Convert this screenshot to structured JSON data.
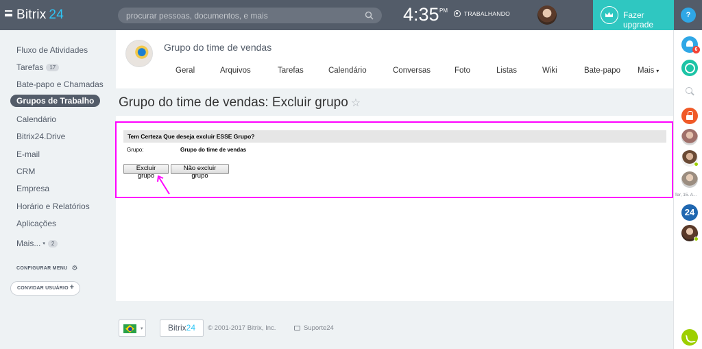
{
  "topbar": {
    "logo_name": "Bitrix",
    "logo_number": "24",
    "search_placeholder": "procurar pessoas, documentos, e mais",
    "time": "4:35",
    "time_period": "PM",
    "work_status": "TRABALHANDO",
    "upgrade_label": "Fazer upgrade",
    "help_label": "?"
  },
  "sidebar": {
    "items": [
      {
        "label": "Fluxo de Atividades"
      },
      {
        "label": "Tarefas",
        "counter": "17"
      },
      {
        "label": "Bate-papo e Chamadas"
      },
      {
        "label": "Grupos de Trabalho",
        "active": true
      },
      {
        "label": "Calendário"
      },
      {
        "label": "Bitrix24.Drive"
      },
      {
        "label": "E-mail"
      },
      {
        "label": "CRM"
      },
      {
        "label": "Empresa"
      },
      {
        "label": "Horário e Relatórios"
      },
      {
        "label": "Aplicações"
      },
      {
        "label": "Mais...",
        "counter": "2"
      }
    ],
    "configure_menu": "CONFIGURAR MENU",
    "invite_user": "CONVIDAR USUÁRIO"
  },
  "group": {
    "name": "Grupo do time de vendas",
    "tabs": [
      "Geral",
      "Arquivos",
      "Tarefas",
      "Calendário",
      "Conversas",
      "Foto",
      "Listas",
      "Wiki",
      "Bate-papo",
      "Mais"
    ]
  },
  "page": {
    "title": "Grupo do time de vendas: Excluir grupo"
  },
  "confirm": {
    "heading": "Tem Certeza Que deseja excluir ESSE Grupo?",
    "group_label": "Grupo:",
    "group_value": "Grupo do time de vendas",
    "delete_button": "Excluir grupo",
    "cancel_button": "Não excluir grupo"
  },
  "footer": {
    "logo_name": "Bitrix",
    "logo_number": "24",
    "copyright": "© 2001-2017 Bitrix, Inc.",
    "support": "Suporte24"
  },
  "right_panel": {
    "notification_count": "6",
    "date_label": "Ter, 15. A...",
    "bitrix_badge": "24"
  },
  "colors": {
    "topbar": "#535c69",
    "accent": "#2fc6f6",
    "upgrade": "#2fc7c1",
    "highlight": "#ff00ff"
  }
}
